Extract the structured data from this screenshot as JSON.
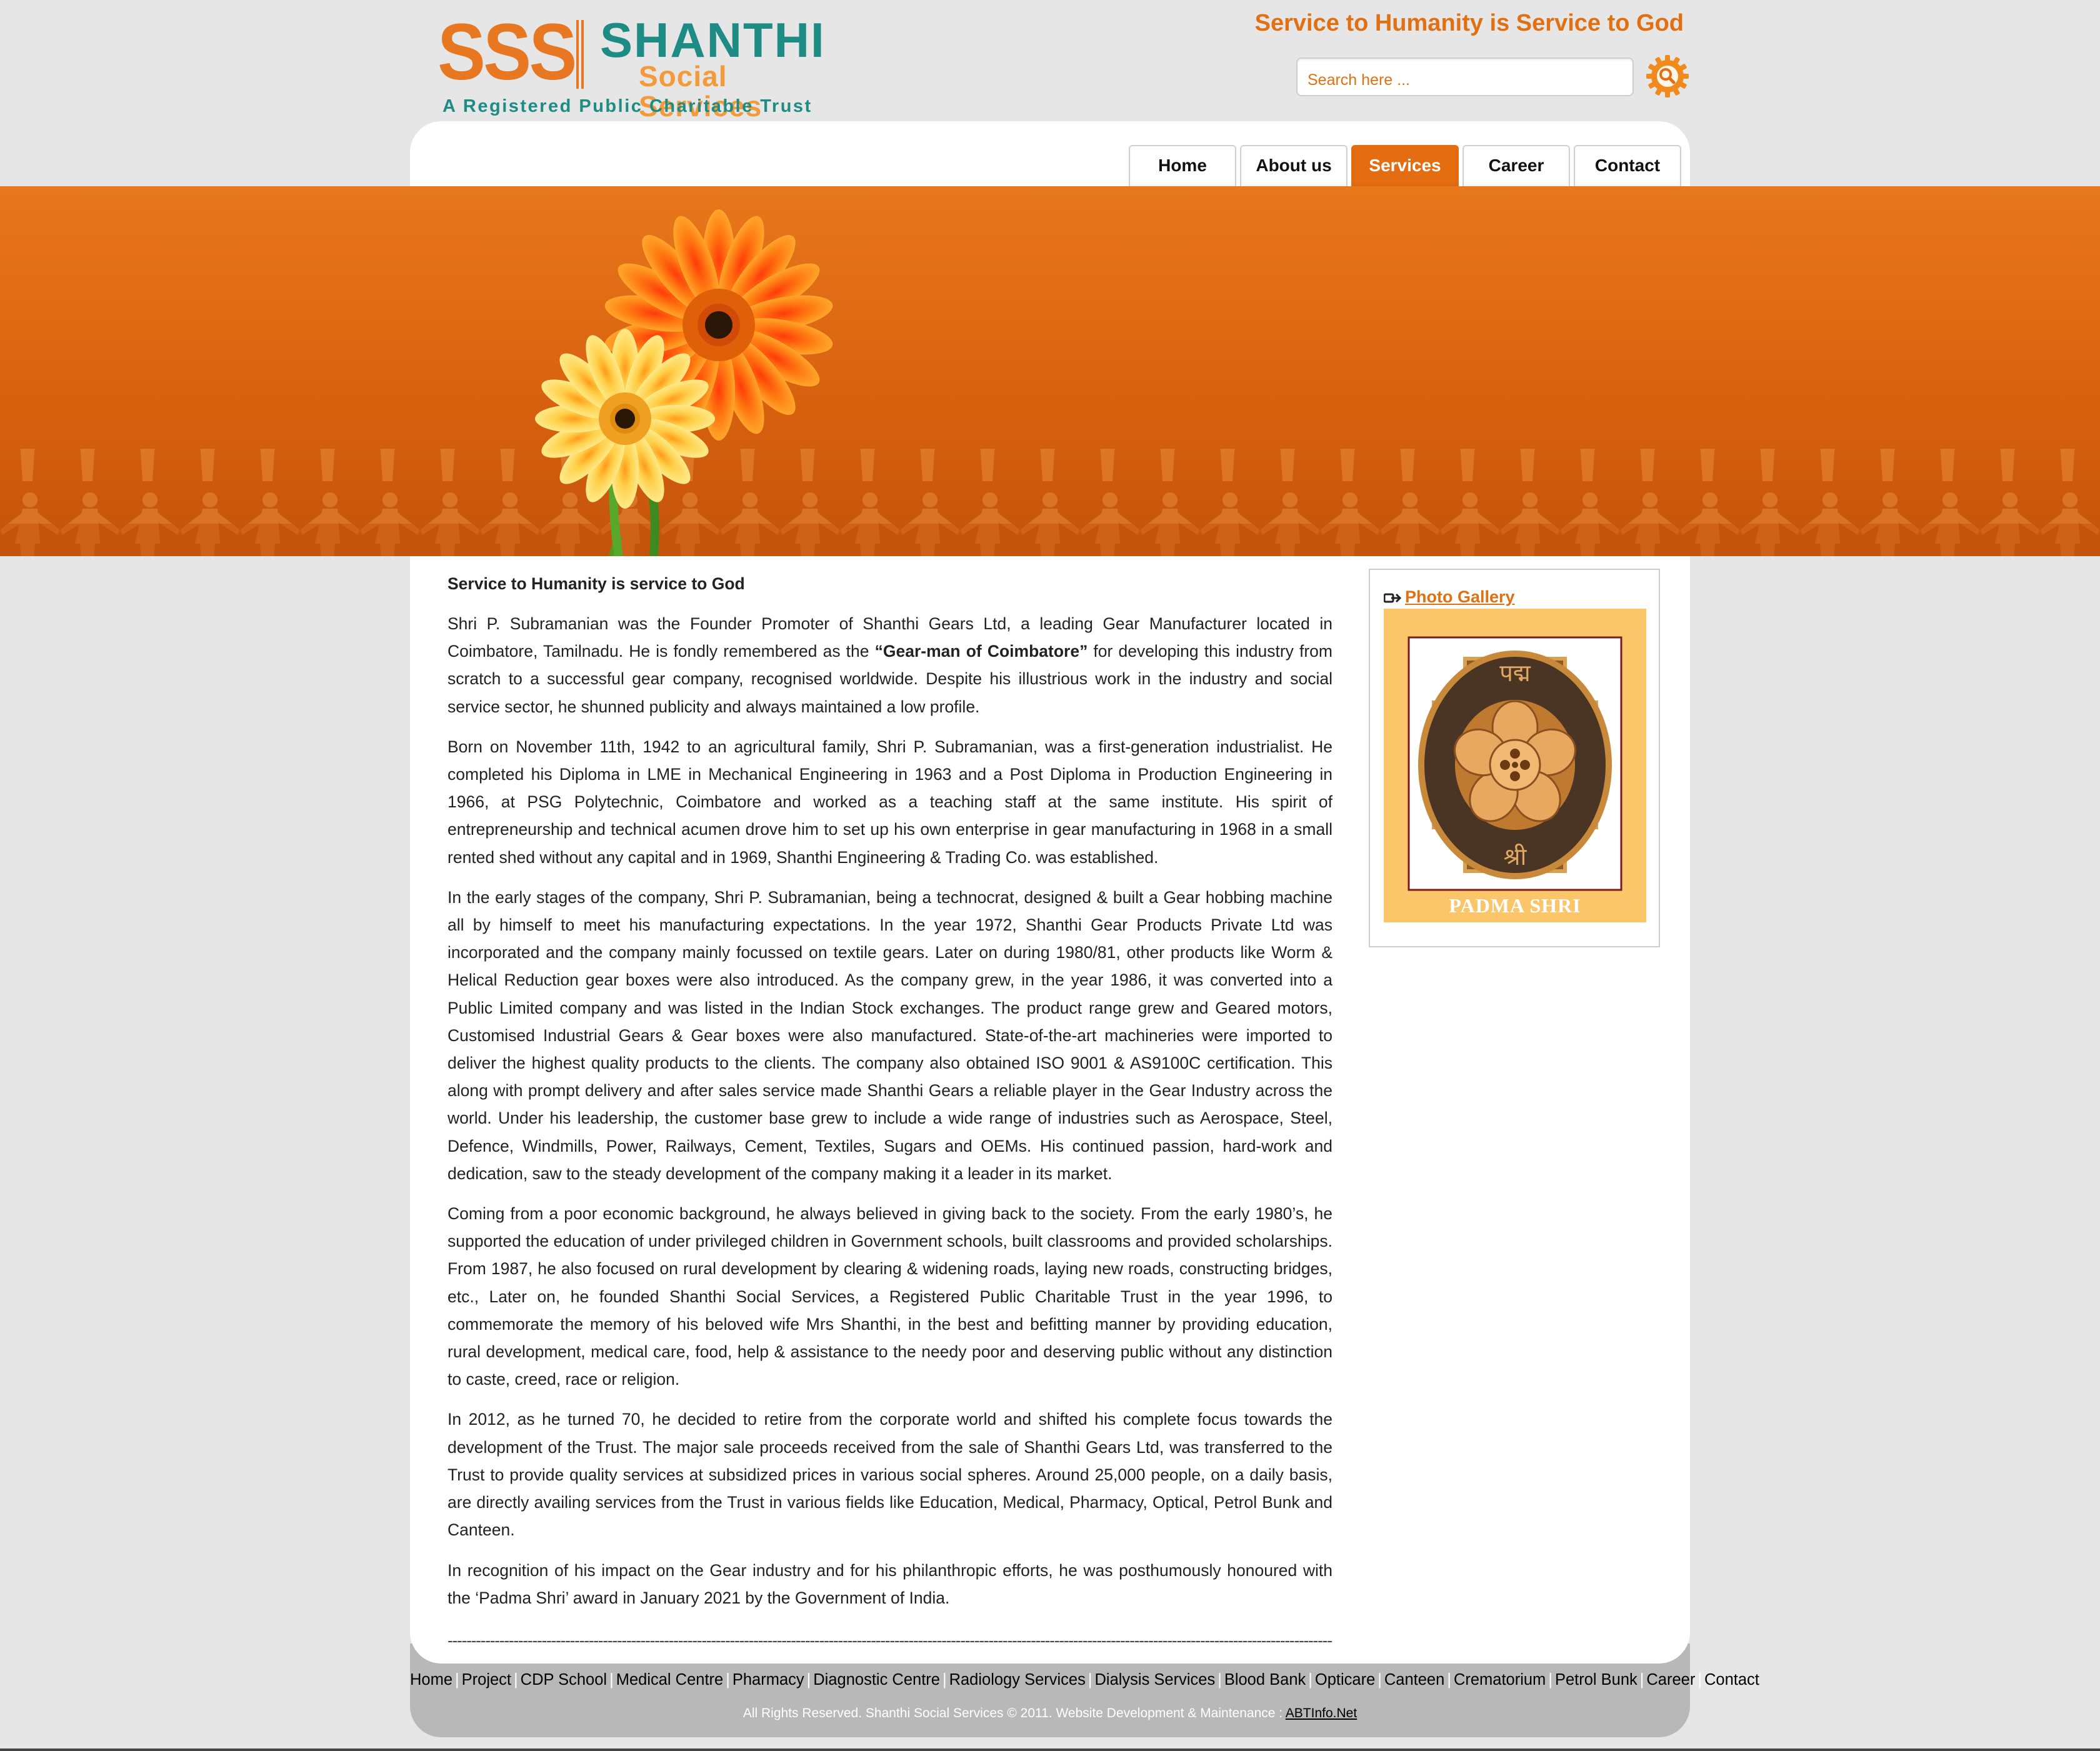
{
  "header": {
    "logo": {
      "sss": "SSS",
      "name": "SHANTHI",
      "sub": "Social Services",
      "tagline": "A Registered Public Charitable Trust"
    },
    "slogan": "Service to Humanity is Service to God",
    "search": {
      "placeholder": "Search here ...",
      "icon": "gear-search-icon"
    }
  },
  "nav": {
    "items": [
      {
        "label": "Home",
        "active": false
      },
      {
        "label": "About us",
        "active": false
      },
      {
        "label": "Services",
        "active": true
      },
      {
        "label": "Career",
        "active": false
      },
      {
        "label": "Contact",
        "active": false
      }
    ]
  },
  "article": {
    "heading": "Service to Humanity is service to God",
    "p1_before": "Shri P. Subramanian was the Founder Promoter of Shanthi Gears Ltd, a leading Gear Manufacturer located in Coimbatore, Tamilnadu. He is fondly remembered as the ",
    "p1_bold": "“Gear-man of Coimbatore”",
    "p1_after": " for developing this industry from scratch to a successful gear company, recognised worldwide. Despite his illustrious work in the industry and social service sector, he shunned publicity and always maintained a low profile.",
    "p2": "Born on November 11th, 1942 to an agricultural family, Shri P. Subramanian, was a first-generation industrialist. He completed his Diploma in LME in Mechanical Engineering in 1963 and a Post Diploma in Production Engineering in 1966, at PSG Polytechnic, Coimbatore and worked as a teaching staff at the same institute. His spirit of entrepreneurship and technical acumen drove him to set up his own enterprise in gear manufacturing in 1968 in a small rented shed without any capital and in 1969, Shanthi Engineering & Trading Co. was established.",
    "p3": "In the early stages of the company, Shri P. Subramanian, being a technocrat, designed & built a Gear hobbing machine all by himself to meet his manufacturing expectations. In the year 1972, Shanthi Gear Products Private Ltd was incorporated and the company mainly focussed on textile gears. Later on during 1980/81, other products like Worm & Helical Reduction gear boxes were also introduced. As the company grew, in the year 1986, it was converted into a Public Limited company and was listed in the Indian Stock exchanges. The product range grew and Geared motors, Customised Industrial Gears & Gear boxes were also manufactured. State-of-the-art machineries were imported to deliver the highest quality products to the clients. The company also obtained ISO 9001 & AS9100C certification. This along with prompt delivery and after sales service made Shanthi Gears a reliable player in the Gear Industry across the world. Under his leadership, the customer base grew to include a wide range of industries such as Aerospace, Steel, Defence, Windmills, Power, Railways, Cement, Textiles, Sugars and OEMs. His continued passion, hard-work and dedication, saw to the steady development of the company making it a leader in its market.",
    "p4": "Coming from a poor economic background, he always believed in giving back to the society. From the early 1980’s, he supported the education of under privileged children in Government schools, built classrooms and provided scholarships. From 1987, he also focused on rural development by clearing & widening roads, laying new roads, constructing bridges, etc., Later on, he founded Shanthi Social Services, a Registered Public Charitable Trust in the year 1996, to commemorate the memory of his beloved wife Mrs Shanthi, in the best and befitting manner by providing education, rural development, medical care, food, help & assistance to the needy poor and deserving public without any distinction to caste, creed, race or religion.",
    "p5": "In 2012, as he turned 70, he decided to retire from the corporate world and shifted his complete focus towards the development of the Trust. The major sale proceeds received from the sale of Shanthi Gears Ltd, was transferred to the Trust to provide quality services at subsidized prices in various social spheres. Around 25,000 people, on a daily basis, are directly availing services from the Trust in various fields like Education, Medical, Pharmacy, Optical, Petrol Bunk and Canteen.",
    "p6": "In recognition of his impact on the Gear industry and for his philanthropic efforts, he was posthumously honoured with the ‘Padma Shri’ award in January 2021 by the Government of India.",
    "divider": "------------------------------------------------------------------------------------------------------------------------------------------------------------------------------------------------------"
  },
  "sidebar": {
    "gallery_link": "Photo Gallery",
    "medal_caption": "PADMA SHRI",
    "medal_top_text": "पद्म",
    "medal_bottom_text": "श्री"
  },
  "footer": {
    "links": [
      "Home",
      "Project",
      "CDP School",
      "Medical Centre",
      "Pharmacy",
      "Diagnostic Centre",
      "Radiology Services",
      "Dialysis Services",
      "Blood Bank",
      "Opticare",
      "Canteen",
      "Crematorium",
      "Petrol Bunk",
      "Career",
      "Contact"
    ],
    "copyright": "All Rights Reserved. Shanthi Social Services © 2011. Website Development & Maintenance : ",
    "dev_link": "ABTInfo.Net"
  },
  "colors": {
    "accent": "#e46d12",
    "teal": "#1e8c84",
    "banner": "#d9620f",
    "medal_bg": "#fbc56a"
  }
}
